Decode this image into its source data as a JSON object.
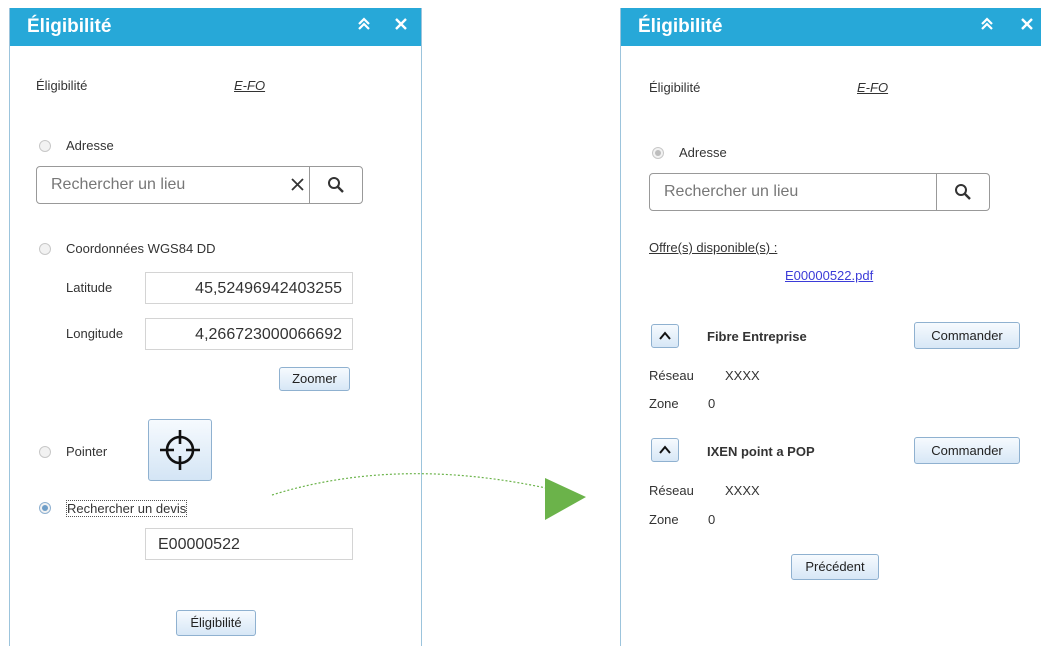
{
  "left_panel": {
    "title": "Éligibilité",
    "eligibilite_label": "Éligibilité",
    "eligibilite_value": "E-FO",
    "adresse_label": "Adresse",
    "search_placeholder": "Rechercher un lieu",
    "coords_label": "Coordonnées WGS84 DD",
    "latitude_label": "Latitude",
    "latitude_value": "45,52496942403255",
    "longitude_label": "Longitude",
    "longitude_value": "4,266723000066692",
    "zoom_button": "Zoomer",
    "pointer_label": "Pointer",
    "devis_label": "Rechercher un devis",
    "devis_value": "E00000522",
    "eligibility_button": "Éligibilité"
  },
  "right_panel": {
    "title": "Éligibilité",
    "eligibilite_label": "Éligibilité",
    "eligibilite_value": "E-FO",
    "adresse_label": "Adresse",
    "search_placeholder": "Rechercher un lieu",
    "offers_heading": "Offre(s) disponible(s) :",
    "pdf_link": "E00000522.pdf",
    "offers": [
      {
        "name": "Fibre Entreprise",
        "button": "Commander",
        "reseau_label": "Réseau",
        "reseau_value": "XXXX",
        "zone_label": "Zone",
        "zone_value": "0"
      },
      {
        "name": "IXEN point a POP",
        "button": "Commander",
        "reseau_label": "Réseau",
        "reseau_value": "XXXX",
        "zone_label": "Zone",
        "zone_value": "0"
      }
    ],
    "previous_button": "Précédent"
  },
  "colors": {
    "header": "#27a8d8",
    "arrow": "#6bb34a",
    "link": "#3b3bd8"
  }
}
